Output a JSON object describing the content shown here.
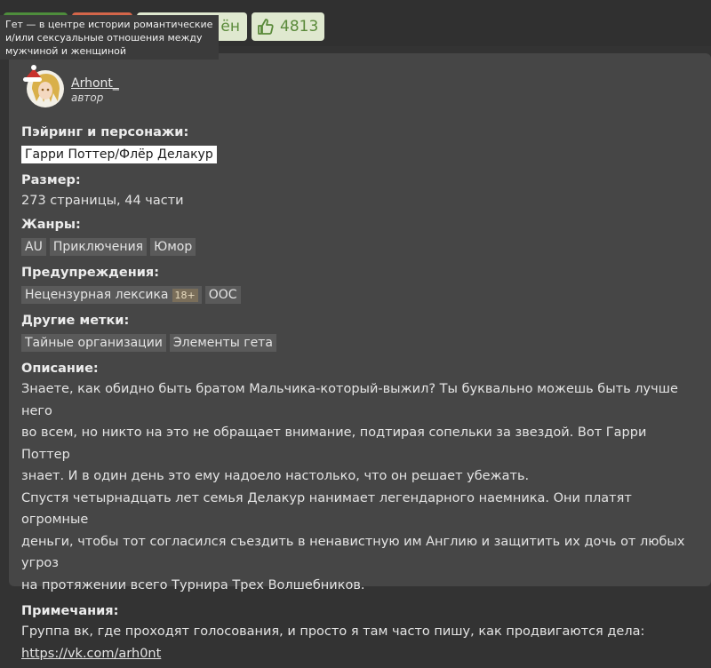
{
  "header": {
    "tooltip_text": "Гет — в центре истории романтические и/или сексуальные отношения между мужчиной и женщиной",
    "status_fragment": "ён",
    "likes": "4813"
  },
  "author": {
    "name": "Arhont_",
    "role": "автор"
  },
  "fields": {
    "pairing_label": "Пэйринг и персонажи:",
    "pairing_value": "Гарри Поттер/Флёр Делакур",
    "size_label": "Размер:",
    "size_value": "273 страницы, 44 части",
    "genres_label": "Жанры:",
    "genres": [
      "AU",
      "Приключения",
      "Юмор"
    ],
    "warnings_label": "Предупреждения:",
    "warnings": [
      "Нецензурная лексика",
      "OOC"
    ],
    "age_badge": "18+",
    "other_tags_label": "Другие метки:",
    "other_tags": [
      "Тайные организации",
      "Элементы гета"
    ],
    "description_label": "Описание:",
    "description_lines": [
      "Знаете, как обидно быть братом Мальчика-который-выжил? Ты буквально можешь быть лучше него",
      "во всем, но никто на это не обращает внимание, подтирая сопельки за звездой. Вот Гарри Поттер",
      "знает. И в один день это ему надоело настолько, что он решает убежать.",
      "Спустя четырнадцать лет семья Делакур нанимает легендарного наемника. Они платят огромные",
      "деньги, чтобы тот согласился съездить в ненавистную им Англию и защитить их дочь от любых угроз",
      "на протяжении всего Турнира Трех Волшебников."
    ],
    "notes_label": "Примечания:",
    "notes_text": "Группа вк, где проходят голосования, и просто я там часто пишу, как продвигаются дела:",
    "notes_link": "https://vk.com/arh0nt"
  },
  "colors": {
    "background": "#333333",
    "panel": "#464646",
    "tag": "#5a5a5a",
    "badge_green": "#4e8d3c",
    "badge_orange": "#d4664a",
    "likes_bg": "#dfe8cf",
    "likes_text": "#5a8a3a"
  },
  "icons": [
    "thumbs-up-icon",
    "avatar-image"
  ]
}
